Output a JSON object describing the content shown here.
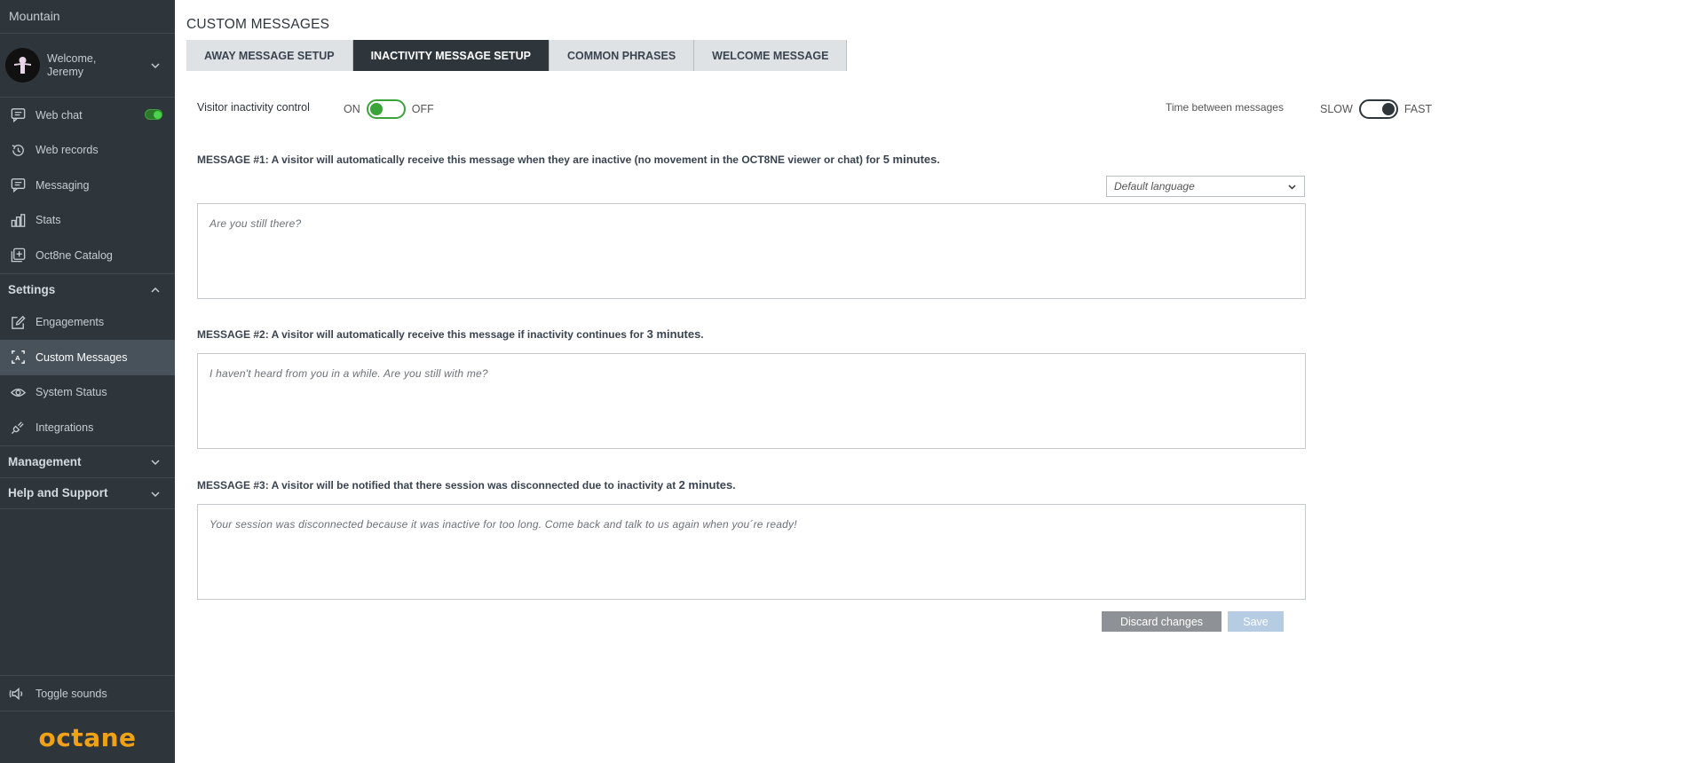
{
  "sidebar": {
    "brand": "Mountain",
    "welcome_line1": "Welcome,",
    "welcome_line2": "Jeremy",
    "items": [
      {
        "label": "Web chat",
        "icon": "chat-bubble-icon"
      },
      {
        "label": "Web records",
        "icon": "history-icon"
      },
      {
        "label": "Messaging",
        "icon": "message-icon"
      },
      {
        "label": "Stats",
        "icon": "bar-chart-icon"
      },
      {
        "label": "Oct8ne Catalog",
        "icon": "catalog-icon"
      }
    ],
    "settings_label": "Settings",
    "settings_items": [
      {
        "label": "Engagements",
        "icon": "edit-icon"
      },
      {
        "label": "Custom Messages",
        "icon": "custom-messages-icon"
      },
      {
        "label": "System Status",
        "icon": "eye-icon"
      },
      {
        "label": "Integrations",
        "icon": "plug-icon"
      }
    ],
    "management_label": "Management",
    "help_label": "Help and Support",
    "toggle_sounds": "Toggle sounds",
    "logo": "octane"
  },
  "page": {
    "title": "CUSTOM MESSAGES",
    "tabs": [
      {
        "label": "AWAY MESSAGE SETUP",
        "active": false
      },
      {
        "label": "INACTIVITY MESSAGE SETUP",
        "active": true
      },
      {
        "label": "COMMON PHRASES",
        "active": false
      },
      {
        "label": "WELCOME MESSAGE",
        "active": false
      }
    ]
  },
  "controls": {
    "visitor_inactivity_label": "Visitor inactivity control",
    "on": "ON",
    "off": "OFF",
    "time_between_label": "Time between messages",
    "slow": "SLOW",
    "fast": "FAST"
  },
  "messages": [
    {
      "label": "MESSAGE #1: A visitor will automatically receive this message when they are inactive (no movement in the OCT8NE viewer or chat) for ",
      "minutes": "5 minutes",
      "suffix": ".",
      "text": "Are you still there?"
    },
    {
      "label": "MESSAGE #2: A visitor will automatically receive this message if inactivity continues for ",
      "minutes": "3 minutes",
      "suffix": ".",
      "text": "I haven't heard from you in a while. Are you still with me?"
    },
    {
      "label": "MESSAGE #3: A visitor will be notified that there session was disconnected due to inactivity at ",
      "minutes": "2 minutes",
      "suffix": ".",
      "text": "Your session was disconnected because it was inactive for too long. Come back and talk to us again when you´re ready!"
    }
  ],
  "language_select": {
    "value": "Default language"
  },
  "buttons": {
    "discard": "Discard changes",
    "save": "Save"
  },
  "colors": {
    "sidebar_bg": "#2e363c",
    "active_tab": "#2e363c",
    "toggle_green": "#3aa33a",
    "logo_orange": "#f0a216"
  }
}
